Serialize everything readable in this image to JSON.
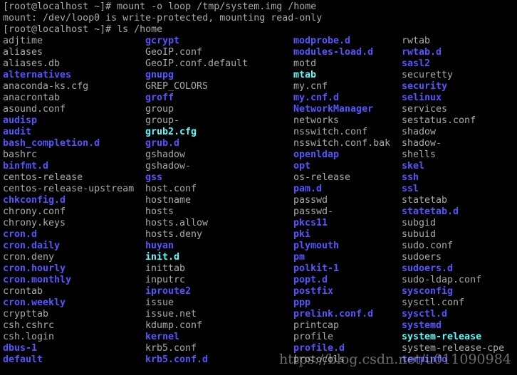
{
  "terminal": {
    "lines": [
      "[root@localhost ~]# mount -o loop /tmp/system.img /home",
      "mount: /dev/loop0 is write-protected, mounting read-only",
      "[root@localhost ~]# ls /home"
    ],
    "colors": {
      "file": "#aaaaaa",
      "directory": "#5555ff",
      "symlink": "#55ffff",
      "background": "#000000"
    },
    "listing": [
      [
        [
          "adjtime",
          "file"
        ],
        [
          "aliases",
          "file"
        ],
        [
          "aliases.db",
          "file"
        ],
        [
          "alternatives",
          "directory"
        ],
        [
          "anaconda-ks.cfg",
          "file"
        ],
        [
          "anacrontab",
          "file"
        ],
        [
          "asound.conf",
          "file"
        ],
        [
          "audisp",
          "directory"
        ],
        [
          "audit",
          "directory"
        ],
        [
          "bash_completion.d",
          "directory"
        ],
        [
          "bashrc",
          "file"
        ],
        [
          "binfmt.d",
          "directory"
        ],
        [
          "centos-release",
          "file"
        ],
        [
          "centos-release-upstream",
          "file"
        ],
        [
          "chkconfig.d",
          "directory"
        ],
        [
          "chrony.conf",
          "file"
        ],
        [
          "chrony.keys",
          "file"
        ],
        [
          "cron.d",
          "directory"
        ],
        [
          "cron.daily",
          "directory"
        ],
        [
          "cron.deny",
          "file"
        ],
        [
          "cron.hourly",
          "directory"
        ],
        [
          "cron.monthly",
          "directory"
        ],
        [
          "crontab",
          "file"
        ],
        [
          "cron.weekly",
          "directory"
        ],
        [
          "crypttab",
          "file"
        ],
        [
          "csh.cshrc",
          "file"
        ],
        [
          "csh.login",
          "file"
        ],
        [
          "dbus-1",
          "directory"
        ],
        [
          "default",
          "directory"
        ]
      ],
      [
        [
          "gcrypt",
          "directory"
        ],
        [
          "GeoIP.conf",
          "file"
        ],
        [
          "GeoIP.conf.default",
          "file"
        ],
        [
          "gnupg",
          "directory"
        ],
        [
          "GREP_COLORS",
          "file"
        ],
        [
          "groff",
          "directory"
        ],
        [
          "group",
          "file"
        ],
        [
          "group-",
          "file"
        ],
        [
          "grub2.cfg",
          "symlink"
        ],
        [
          "grub.d",
          "directory"
        ],
        [
          "gshadow",
          "file"
        ],
        [
          "gshadow-",
          "file"
        ],
        [
          "gss",
          "directory"
        ],
        [
          "host.conf",
          "file"
        ],
        [
          "hostname",
          "file"
        ],
        [
          "hosts",
          "file"
        ],
        [
          "hosts.allow",
          "file"
        ],
        [
          "hosts.deny",
          "file"
        ],
        [
          "huyan",
          "directory"
        ],
        [
          "init.d",
          "symlink"
        ],
        [
          "inittab",
          "file"
        ],
        [
          "inputrc",
          "file"
        ],
        [
          "iproute2",
          "directory"
        ],
        [
          "issue",
          "file"
        ],
        [
          "issue.net",
          "file"
        ],
        [
          "kdump.conf",
          "file"
        ],
        [
          "kernel",
          "directory"
        ],
        [
          "krb5.conf",
          "file"
        ],
        [
          "krb5.conf.d",
          "directory"
        ]
      ],
      [
        [
          "modprobe.d",
          "directory"
        ],
        [
          "modules-load.d",
          "directory"
        ],
        [
          "motd",
          "file"
        ],
        [
          "mtab",
          "symlink"
        ],
        [
          "my.cnf",
          "file"
        ],
        [
          "my.cnf.d",
          "directory"
        ],
        [
          "NetworkManager",
          "directory"
        ],
        [
          "networks",
          "file"
        ],
        [
          "nsswitch.conf",
          "file"
        ],
        [
          "nsswitch.conf.bak",
          "file"
        ],
        [
          "openldap",
          "directory"
        ],
        [
          "opt",
          "directory"
        ],
        [
          "os-release",
          "file"
        ],
        [
          "pam.d",
          "directory"
        ],
        [
          "passwd",
          "file"
        ],
        [
          "passwd-",
          "file"
        ],
        [
          "pkcs11",
          "directory"
        ],
        [
          "pki",
          "directory"
        ],
        [
          "plymouth",
          "directory"
        ],
        [
          "pm",
          "directory"
        ],
        [
          "polkit-1",
          "directory"
        ],
        [
          "popt.d",
          "directory"
        ],
        [
          "postfix",
          "directory"
        ],
        [
          "ppp",
          "directory"
        ],
        [
          "prelink.conf.d",
          "directory"
        ],
        [
          "printcap",
          "file"
        ],
        [
          "profile",
          "file"
        ],
        [
          "profile.d",
          "directory"
        ],
        [
          "protocols",
          "file"
        ]
      ],
      [
        [
          "rwtab",
          "file"
        ],
        [
          "rwtab.d",
          "directory"
        ],
        [
          "sasl2",
          "directory"
        ],
        [
          "securetty",
          "file"
        ],
        [
          "security",
          "directory"
        ],
        [
          "selinux",
          "directory"
        ],
        [
          "services",
          "file"
        ],
        [
          "sestatus.conf",
          "file"
        ],
        [
          "shadow",
          "file"
        ],
        [
          "shadow-",
          "file"
        ],
        [
          "shells",
          "file"
        ],
        [
          "skel",
          "directory"
        ],
        [
          "ssh",
          "directory"
        ],
        [
          "ssl",
          "directory"
        ],
        [
          "statetab",
          "file"
        ],
        [
          "statetab.d",
          "directory"
        ],
        [
          "subgid",
          "file"
        ],
        [
          "subuid",
          "file"
        ],
        [
          "sudo.conf",
          "file"
        ],
        [
          "sudoers",
          "file"
        ],
        [
          "sudoers.d",
          "directory"
        ],
        [
          "sudo-ldap.conf",
          "file"
        ],
        [
          "sysconfig",
          "directory"
        ],
        [
          "sysctl.conf",
          "file"
        ],
        [
          "sysctl.d",
          "directory"
        ],
        [
          "systemd",
          "directory"
        ],
        [
          "system-release",
          "symlink"
        ],
        [
          "system-release-cpe",
          "file"
        ],
        [
          "terminfo",
          "directory"
        ]
      ]
    ]
  },
  "watermark": "https://blog.csdn.net/u011090984"
}
